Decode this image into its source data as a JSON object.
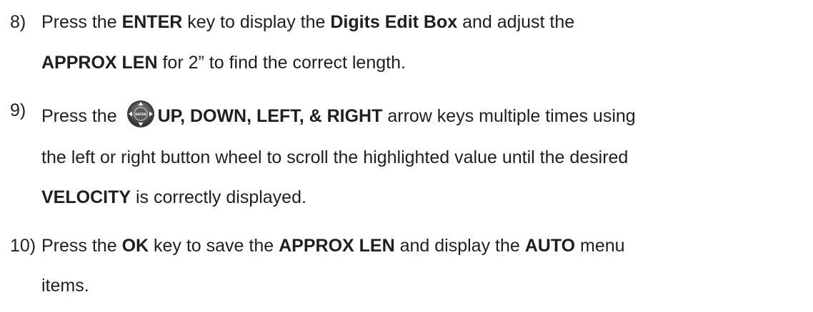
{
  "steps": [
    {
      "number": "8)",
      "line1": {
        "a": "Press the ",
        "b1": "ENTER",
        "c": " key to display the ",
        "b2": "Digits Edit Box",
        "d": " and adjust the"
      },
      "line2": {
        "b1": "APPROX LEN",
        "c": " for 2” to find the correct length."
      }
    },
    {
      "number": "9)",
      "line1": {
        "a": "Press the ",
        "icon": "enter-dpad-icon",
        "b1": "UP, DOWN, LEFT, & RIGHT",
        "c": " arrow keys multiple times using"
      },
      "line2": {
        "a": "the left or right button wheel to scroll the highlighted value until the desired"
      },
      "line3": {
        "b1": "VELOCITY",
        "c": " is correctly displayed."
      }
    },
    {
      "number": "10)",
      "line1": {
        "a": "Press the ",
        "b1": "OK",
        "c": " key to save the ",
        "b2": "APPROX LEN",
        "d": " and display the ",
        "b3": "AUTO",
        "e": " menu"
      },
      "line2": {
        "a": "items."
      }
    }
  ]
}
